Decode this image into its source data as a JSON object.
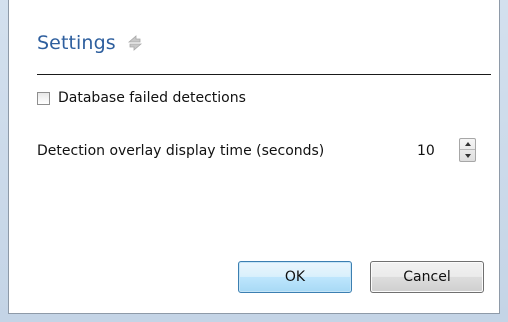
{
  "settings": {
    "title": "Settings",
    "refresh_icon": "refresh-icon"
  },
  "options": {
    "database_failed_detections": {
      "label": "Database failed detections",
      "checked": false
    },
    "overlay_display_time": {
      "label": "Detection overlay display time (seconds)",
      "value": "10"
    }
  },
  "buttons": {
    "ok_label": "OK",
    "cancel_label": "Cancel"
  },
  "colors": {
    "title": "#2e5f9e",
    "ok_border": "#3c7fb1"
  }
}
